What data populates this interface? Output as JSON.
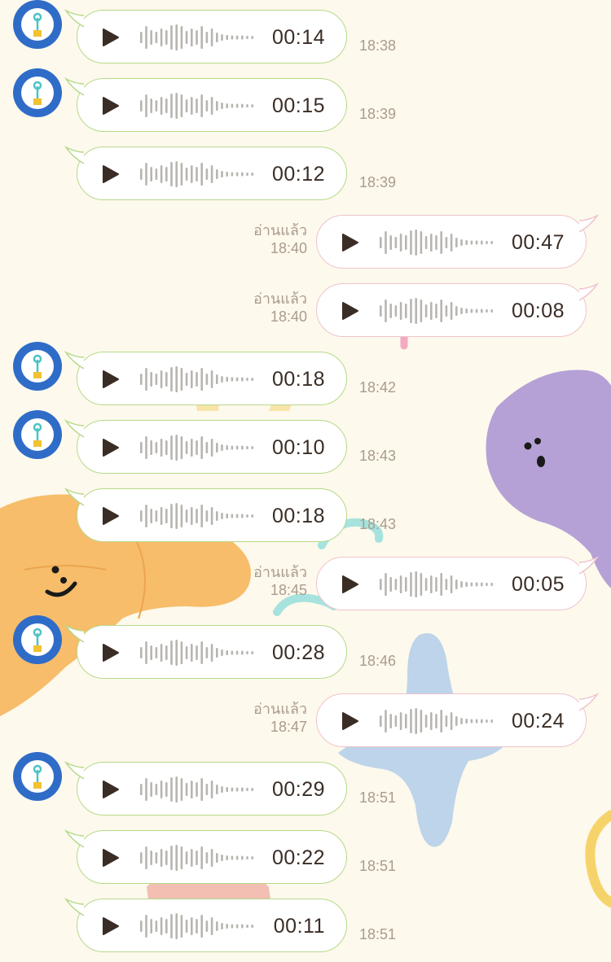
{
  "colors": {
    "background": "#fdf9ec",
    "avatar_blue": "#2f6cc8",
    "incoming_border": "#b7d98a",
    "outgoing_border": "#efc3cc",
    "play_icon": "#3a2d25",
    "wave": "#b8b5b0",
    "meta_text": "#a99c8f"
  },
  "icons": {
    "avatar": "lightbulb-avatar-icon",
    "play": "play-icon",
    "waveform": "waveform-icon"
  },
  "messages": [
    {
      "direction": "in",
      "avatar": true,
      "duration": "00:14",
      "time": "18:38"
    },
    {
      "direction": "in",
      "avatar": true,
      "duration": "00:15",
      "time": "18:39"
    },
    {
      "direction": "in",
      "avatar": false,
      "duration": "00:12",
      "time": "18:39"
    },
    {
      "direction": "out",
      "read": "อ่านแล้ว",
      "duration": "00:47",
      "time": "18:40"
    },
    {
      "direction": "out",
      "read": "อ่านแล้ว",
      "duration": "00:08",
      "time": "18:40"
    },
    {
      "direction": "in",
      "avatar": true,
      "duration": "00:18",
      "time": "18:42"
    },
    {
      "direction": "in",
      "avatar": true,
      "duration": "00:10",
      "time": "18:43"
    },
    {
      "direction": "in",
      "avatar": false,
      "duration": "00:18",
      "time": "18:43"
    },
    {
      "direction": "out",
      "read": "อ่านแล้ว",
      "duration": "00:05",
      "time": "18:45"
    },
    {
      "direction": "in",
      "avatar": true,
      "duration": "00:28",
      "time": "18:46"
    },
    {
      "direction": "out",
      "read": "อ่านแล้ว",
      "duration": "00:24",
      "time": "18:47"
    },
    {
      "direction": "in",
      "avatar": true,
      "duration": "00:29",
      "time": "18:51"
    },
    {
      "direction": "in",
      "avatar": false,
      "duration": "00:22",
      "time": "18:51"
    },
    {
      "direction": "in",
      "avatar": false,
      "duration": "00:11",
      "time": "18:51"
    }
  ]
}
